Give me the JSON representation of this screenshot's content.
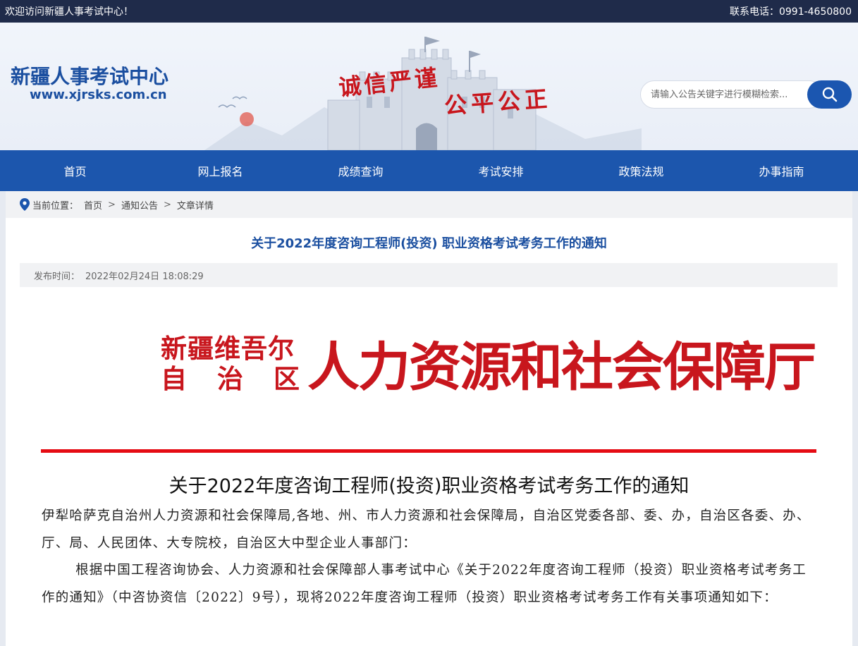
{
  "topbar": {
    "welcome": "欢迎访问新疆人事考试中心！",
    "phone": "联系电话：0991-4650800"
  },
  "header": {
    "site_name": "新疆人事考试中心",
    "site_url": "www.xjrsks.com.cn",
    "slogan_left": "诚信严谨",
    "slogan_right": "公平公正",
    "search_placeholder": "请输入公告关键字进行模糊检索...",
    "search_icon": "search-icon"
  },
  "nav": {
    "items": [
      "首页",
      "网上报名",
      "成绩查询",
      "考试安排",
      "政策法规",
      "办事指南"
    ]
  },
  "breadcrumb": {
    "label": "当前位置：",
    "home": "首页",
    "section": "通知公告",
    "current": "文章详情",
    "separator": ">",
    "icon": "location-pin-icon"
  },
  "article": {
    "title": "关于2022年度咨询工程师(投资) 职业资格考试考务工作的通知",
    "publish_label": "发布时间：",
    "publish_time": "2022年02月24日 18:08:29"
  },
  "document": {
    "org_left_line1": "新疆维吾尔",
    "org_left_line2": [
      "自",
      "治",
      "区"
    ],
    "org_right": "人力资源和社会保障厅",
    "title": "关于2022年度咨询工程师(投资)职业资格考试考务工作的通知",
    "para1": "伊犁哈萨克自治州人力资源和社会保障局,各地、州、市人力资源和社会保障局，自治区党委各部、委、办，自治区各委、办、厅、局、人民团体、大专院校，自治区大中型企业人事部门：",
    "para2": "根据中国工程咨询协会、人力资源和社会保障部人事考试中心《关于2022年度咨询工程师（投资）职业资格考试考务工作的通知》（中咨协资信〔2022〕9号），现将2022年度咨询工程师（投资）职业资格考试考务工作有关事项通知如下："
  },
  "colors": {
    "topbar": "#1f2b4a",
    "brand_blue": "#1c56ad",
    "seal_red": "#c8161d",
    "rule_red": "#e50b13"
  }
}
